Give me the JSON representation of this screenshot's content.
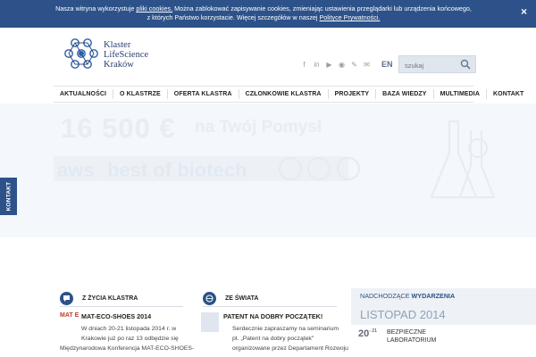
{
  "cookie": {
    "line1_pre": "Nasza witryna wykorzystuje ",
    "line1_link": "pliki cookies.",
    "line1_post": " Można zablokować zapisywanie cookies, zmieniając ustawienia przeglądarki lub urządzenia końcowego,",
    "line2_pre": "z których Państwo korzystacie. Więcej szczegółów w naszej ",
    "line2_link": "Polityce Prywatności.",
    "close_label": "×"
  },
  "logo": {
    "line1": "Klaster",
    "line2": "LifeScience",
    "line3": "Kraków"
  },
  "social": [
    "f",
    "in",
    "▶",
    "◉",
    "✎",
    "✉"
  ],
  "lang": "EN",
  "search": {
    "placeholder": "szukaj"
  },
  "nav": [
    "AKTUALNOŚCI",
    "O KLASTRZE",
    "OFERTA KLASTRA",
    "CZŁONKOWIE KLASTRA",
    "PROJEKTY",
    "BAZA WIEDZY",
    "MULTIMEDIA",
    "KONTAKT"
  ],
  "hero": {
    "amount": "16 500 €",
    "tagline": "na Twój Pomysł",
    "aws": "aws",
    "best": "best of biotech"
  },
  "side_tab": "KONTAKT",
  "column1": {
    "title": "Z ŻYCIA KLASTRA",
    "thumb": "MAT E",
    "news_title": "MAT-ECO-SHOES 2014",
    "news_lines": [
      "W dniach 20-21 listopada 2014 r. w",
      "Krakowie już po raz 13 odbędzie się",
      "Międzynarodowa Konferencja MAT-ECO-SHOES-"
    ]
  },
  "column2": {
    "title": "ZE ŚWIATA",
    "news_title": "PATENT NA DOBRY POCZĄTEK!",
    "news_lines": [
      "Serdecznie zapraszamy na seminarium",
      "pt. „Patent na dobry początek\"",
      "organizowane przez Departament Rozwoju"
    ]
  },
  "events": {
    "head_pre": "NADCHODZĄCE ",
    "head_bold": "WYDARZENIA",
    "month": "LISTOPAD 2014",
    "date": "20",
    "date_sup": "- 21",
    "event_line1": "BEZPIECZNE",
    "event_line2": "LABORATORIUM"
  }
}
